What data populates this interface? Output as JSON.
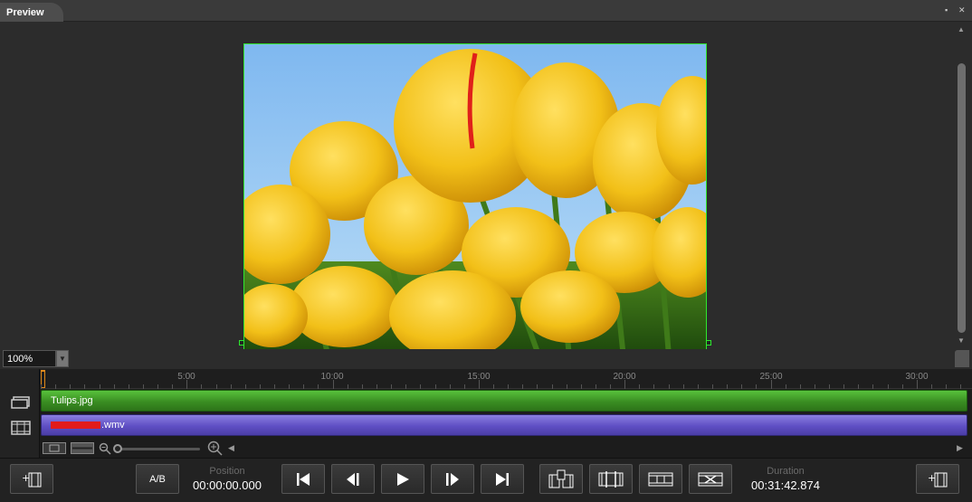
{
  "window": {
    "tab_title": "Preview"
  },
  "zoom": {
    "value": "100%"
  },
  "ruler": {
    "ticks": [
      "5:00",
      "10:00",
      "15:00",
      "20:00",
      "25:00",
      "30:00"
    ]
  },
  "tracks": [
    {
      "name": "Tulips.jpg",
      "kind": "image",
      "color": "#4aa82e"
    },
    {
      "name": ".wmv",
      "kind": "video",
      "color": "#6254cc"
    }
  ],
  "transport": {
    "ab_label": "A/B",
    "position_label": "Position",
    "position_value": "00:00:00.000",
    "duration_label": "Duration",
    "duration_value": "00:31:42.874"
  },
  "icons": {
    "add_left": "add-media-icon",
    "prev": "skip-to-start-icon",
    "step_back": "step-back-icon",
    "play": "play-icon",
    "step_fwd": "step-forward-icon",
    "next": "skip-to-end-icon",
    "add_right": "add-media-icon"
  },
  "colors": {
    "accent_green": "#2ee82e",
    "playhead": "#e08a1c"
  }
}
